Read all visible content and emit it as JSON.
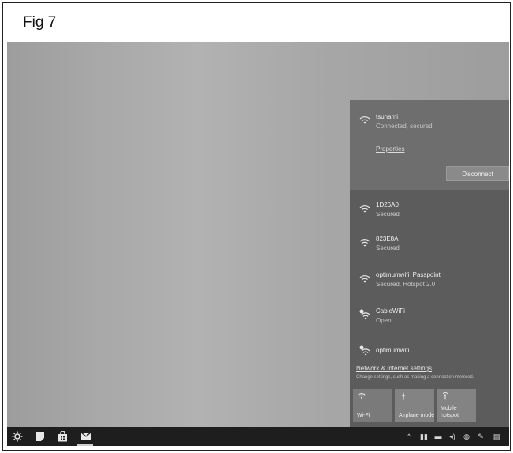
{
  "figure": {
    "label": "Fig 7"
  },
  "flyout": {
    "connected": {
      "name": "tsunami",
      "status": "Connected, secured",
      "properties_label": "Properties",
      "disconnect_label": "Disconnect"
    },
    "networks": [
      {
        "name": "1D26A0",
        "status": "Secured",
        "icon": "wifi-secured-icon"
      },
      {
        "name": "823E8A",
        "status": "Secured",
        "icon": "wifi-secured-icon"
      },
      {
        "name": "optimumwifi_Passpoint",
        "status": "Secured, Hotspot 2.0",
        "icon": "wifi-secured-icon"
      },
      {
        "name": "CableWiFi",
        "status": "Open",
        "icon": "wifi-open-icon"
      },
      {
        "name": "optimumwifi",
        "status": "",
        "icon": "wifi-open-icon"
      }
    ],
    "settings_link": "Network & Internet settings",
    "settings_desc": "Change settings, such as making a connection metered.",
    "quick_actions": [
      {
        "label": "Wi-Fi",
        "icon": "wifi-icon",
        "active": true
      },
      {
        "label": "Airplane mode",
        "icon": "airplane-icon",
        "active": false
      },
      {
        "label": "Mobile hotspot",
        "icon": "hotspot-icon",
        "active": false
      }
    ]
  },
  "taskbar": {
    "left_icons": [
      "settings-icon",
      "notes-icon",
      "store-icon",
      "mail-icon"
    ],
    "tray_icons": [
      "chevron-up-icon",
      "network-icon",
      "battery-icon",
      "volume-icon",
      "language-icon",
      "pen-icon",
      "action-center-icon"
    ]
  },
  "colors": {
    "flyout_bg": "#5c5c5c",
    "connected_bg": "#6e6e6e",
    "taskbar_bg": "#1e1e1e"
  }
}
